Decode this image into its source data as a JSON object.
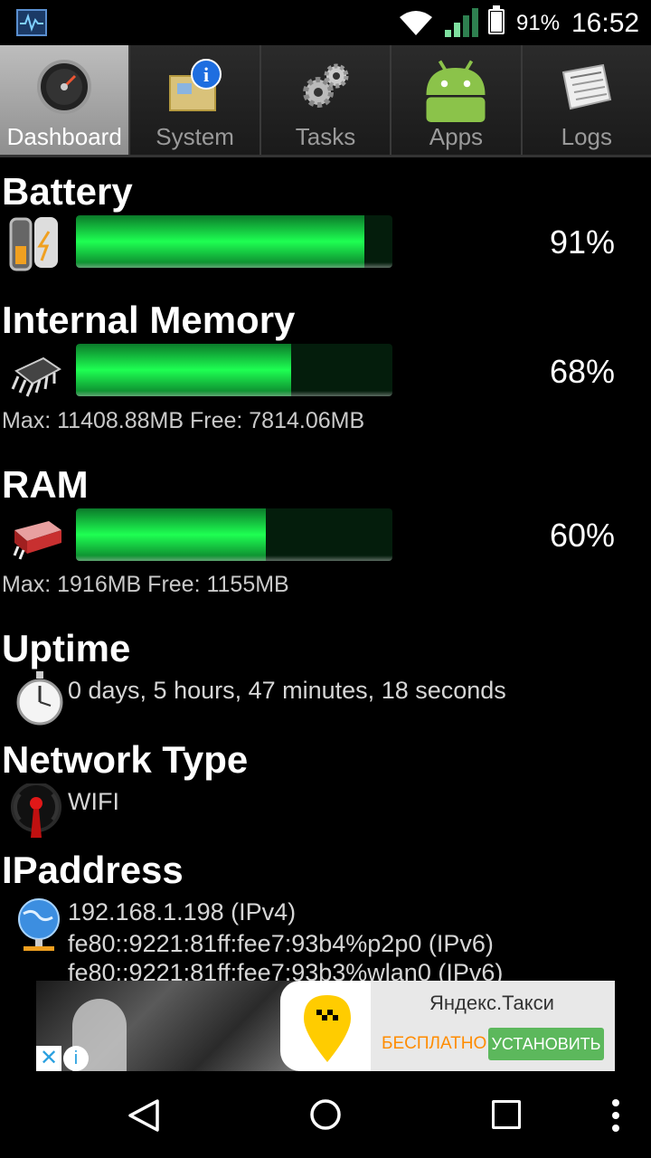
{
  "status_bar": {
    "app_icon": "system-monitor-icon",
    "wifi_icon": "wifi-icon",
    "signal_icon": "cell-signal-icon",
    "battery_icon": "battery-icon",
    "battery_text": "91%",
    "time": "16:52"
  },
  "tabs": [
    {
      "label": "Dashboard",
      "icon": "gauge-icon",
      "active": true
    },
    {
      "label": "System",
      "icon": "system-info-icon",
      "active": false
    },
    {
      "label": "Tasks",
      "icon": "gears-icon",
      "active": false
    },
    {
      "label": "Apps",
      "icon": "android-icon",
      "active": false
    },
    {
      "label": "Logs",
      "icon": "newspaper-icon",
      "active": false
    }
  ],
  "battery": {
    "title": "Battery",
    "percent_label": "91%",
    "level": 0.91,
    "icon": "battery-icon"
  },
  "memory": {
    "title": "Internal Memory",
    "percent_label": "68%",
    "level": 0.68,
    "icon": "chip-icon",
    "detail": "Max: 11408.88MB Free: 7814.06MB"
  },
  "ram": {
    "title": "RAM",
    "percent_label": "60%",
    "level": 0.6,
    "icon": "ram-icon",
    "detail": "Max: 1916MB Free: 1155MB"
  },
  "uptime": {
    "title": "Uptime",
    "value": "0 days, 5 hours, 47 minutes, 18 seconds",
    "icon": "stopwatch-icon"
  },
  "network": {
    "title": "Network Type",
    "value": "WIFI",
    "icon": "antenna-icon"
  },
  "ip": {
    "title": "IPaddress",
    "icon": "globe-icon",
    "addresses": [
      "192.168.1.198 (IPv4)",
      "fe80::9221:81ff:fee7:93b4%p2p0 (IPv6)",
      "fe80::9221:81ff:fee7:93b3%wlan0 (IPv6)"
    ]
  },
  "ad": {
    "title": "Яндекс.Такси",
    "free_label": "БЕСПЛАТНО",
    "install_label": "УСТАНОВИТЬ",
    "close_glyph": "✕",
    "info_glyph": "i"
  },
  "navbar": {
    "back_icon": "back-icon",
    "home_icon": "home-icon",
    "recents_icon": "recents-icon",
    "more_icon": "more-icon"
  },
  "colors": {
    "bar_fill": "#1eff52",
    "bar_track": "#041d0c",
    "active_tab": "#a8a8a8",
    "ad_install": "#5cb85c",
    "ad_free": "#ff8c00"
  }
}
